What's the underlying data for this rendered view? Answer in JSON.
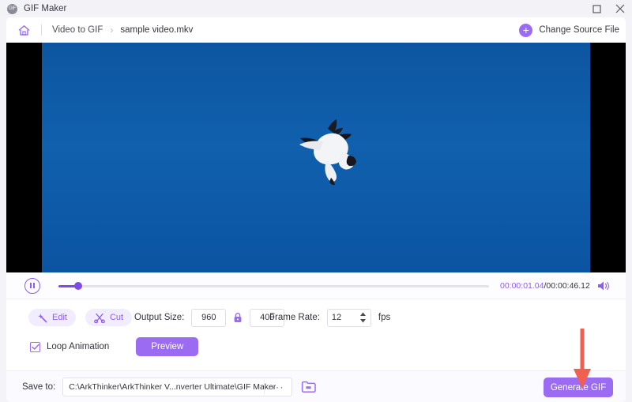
{
  "window": {
    "title": "GIF Maker",
    "app_icon": "gif-app-icon",
    "maximize_icon": "maximize-icon",
    "close_icon": "close-icon"
  },
  "breadcrumb": {
    "home_icon": "home-icon",
    "module": "Video to GIF",
    "separator": "›",
    "file": "sample video.mkv"
  },
  "change_source": {
    "icon": "plus-circle-icon",
    "label": "Change Source File"
  },
  "player": {
    "pause_icon": "pause-icon",
    "current_time": "00:00:01.04",
    "time_separator": "/",
    "total_time": "00:00:46.12",
    "volume_icon": "volume-icon",
    "progress_percent": 4
  },
  "options": {
    "edit": {
      "icon": "magic-wand-icon",
      "label": "Edit"
    },
    "cut": {
      "icon": "scissors-icon",
      "label": "Cut"
    },
    "output_size": {
      "label": "Output Size:",
      "width": "960",
      "height": "400",
      "lock_icon": "lock-closed-icon"
    },
    "frame_rate": {
      "label": "Frame Rate:",
      "value": "12",
      "unit": "fps",
      "spinner_icon": "spinner-arrows-icon"
    },
    "loop": {
      "label": "Loop Animation",
      "checked": true,
      "check_icon": "checkmark-icon"
    },
    "preview_label": "Preview"
  },
  "footer": {
    "save_to_label": "Save to:",
    "path": "C:\\ArkThinker\\ArkThinker V...nverter Ultimate\\GIF Maker",
    "browse_label": "···",
    "folder_icon": "folder-open-icon",
    "generate_label": "Generate GIF"
  },
  "annotation": {
    "arrow_icon": "down-arrow-annotation",
    "color": "#ef5f52"
  },
  "colors": {
    "accent": "#9b6cf2",
    "accent_dark": "#7d4ce8",
    "video_sky": "#1060ae",
    "letterbox": "#000000"
  }
}
